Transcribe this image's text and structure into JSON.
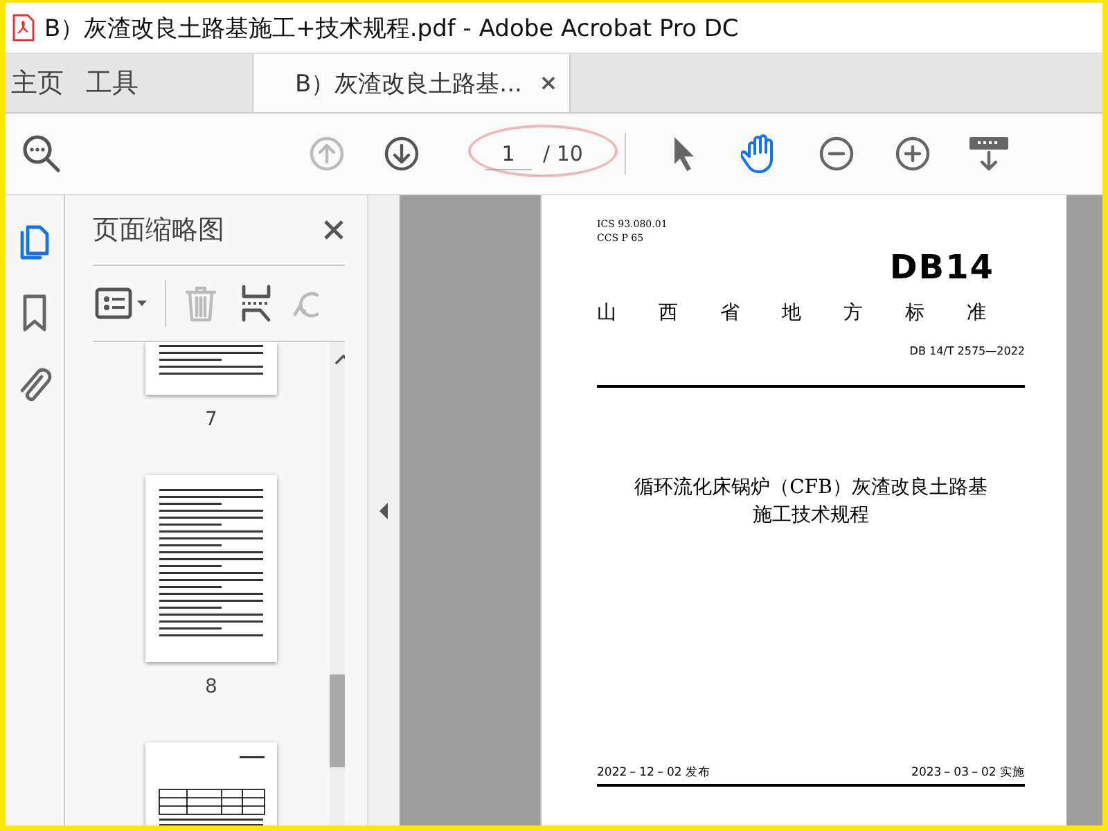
{
  "window": {
    "title": "B）灰渣改良土路基施工+技术规程.pdf - Adobe Acrobat Pro DC"
  },
  "tabs": [
    {
      "label": "主页",
      "selected": false
    },
    {
      "label": "工具",
      "selected": false
    },
    {
      "label": "B）灰渣改良土路基...",
      "selected": true
    }
  ],
  "toolbar": {
    "nav": [
      {
        "kind": "up",
        "disabled": true
      },
      {
        "kind": "down",
        "disabled": false
      }
    ],
    "page_field": {
      "value": "1",
      "total": "/ 10"
    },
    "tools": [
      {
        "kind": "select",
        "selected": false
      },
      {
        "kind": "hand",
        "selected": true
      },
      {
        "kind": "zoom-out",
        "selected": false
      },
      {
        "kind": "zoom-in",
        "selected": false
      },
      {
        "kind": "keyboard",
        "selected": false
      }
    ]
  },
  "rail": [
    {
      "kind": "pages",
      "selected": true
    },
    {
      "kind": "bookmarks",
      "selected": false
    },
    {
      "kind": "attachments",
      "selected": false
    }
  ],
  "panel": {
    "title": "页面缩略图",
    "thumbnails": [
      {
        "kind": "text-end",
        "label": "7"
      },
      {
        "kind": "text",
        "label": "8"
      },
      {
        "kind": "table"
      }
    ]
  },
  "document": {
    "ics": "ICS  93.080.01",
    "ccs": "CCS  P 65",
    "logo": "DB14",
    "heading": "山西省地方标准",
    "code": "DB 14/T 2575—2022",
    "title_lines": [
      "循环流化床锅炉（CFB）灰渣改良土路基",
      "施工技术规程"
    ],
    "issued": "2022－12－02 发布",
    "effective": "2023－03－02 实施"
  }
}
